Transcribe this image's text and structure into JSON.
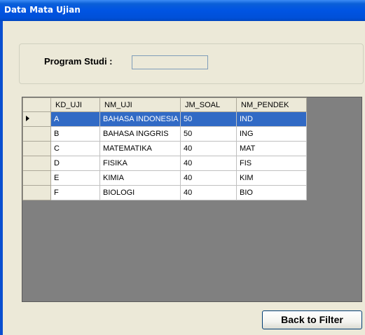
{
  "window": {
    "title": "Data Mata Ujian"
  },
  "filter": {
    "label": "Program Studi :",
    "value": ""
  },
  "table": {
    "columns": [
      "KD_UJI",
      "NM_UJI",
      "JM_SOAL",
      "NM_PENDEK"
    ],
    "rows": [
      [
        "A",
        "BAHASA INDONESIA",
        "50",
        "IND"
      ],
      [
        "B",
        "BAHASA INGGRIS",
        "50",
        "ING"
      ],
      [
        "C",
        "MATEMATIKA",
        "40",
        "MAT"
      ],
      [
        "D",
        "FISIKA",
        "40",
        "FIS"
      ],
      [
        "E",
        "KIMIA",
        "40",
        "KIM"
      ],
      [
        "F",
        "BIOLOGI",
        "40",
        "BIO"
      ]
    ],
    "selected_row": 0,
    "colors": {
      "selection": "#316ac5",
      "empty_area": "#808080"
    }
  },
  "buttons": {
    "back": "Back to Filter"
  }
}
